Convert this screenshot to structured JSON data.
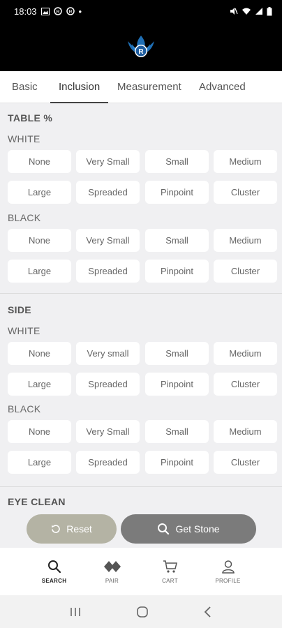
{
  "status_bar": {
    "time": "18:03",
    "dot": "•"
  },
  "app": {
    "logo_letter": "R"
  },
  "tabs": [
    {
      "label": "Basic"
    },
    {
      "label": "Inclusion",
      "active": true
    },
    {
      "label": "Measurement"
    },
    {
      "label": "Advanced"
    }
  ],
  "sections": {
    "table": {
      "title": "TABLE %",
      "white": {
        "label": "WHITE",
        "options": [
          "None",
          "Very Small",
          "Small",
          "Medium",
          "Large",
          "Spreaded",
          "Pinpoint",
          "Cluster"
        ]
      },
      "black": {
        "label": "BLACK",
        "options": [
          "None",
          "Very Small",
          "Small",
          "Medium",
          "Large",
          "Spreaded",
          "Pinpoint",
          "Cluster"
        ]
      }
    },
    "side": {
      "title": "SIDE",
      "white": {
        "label": "WHITE",
        "options": [
          "None",
          "Very small",
          "Small",
          "Medium",
          "Large",
          "Spreaded",
          "Pinpoint",
          "Cluster"
        ]
      },
      "black": {
        "label": "BLACK",
        "options": [
          "None",
          "Very Small",
          "Small",
          "Medium",
          "Large",
          "Spreaded",
          "Pinpoint",
          "Cluster"
        ]
      }
    },
    "eye_clean": {
      "title": "EYE CLEAN"
    }
  },
  "actions": {
    "reset_label": "Reset",
    "get_stone_label": "Get Stone"
  },
  "bottom_nav": [
    {
      "label": "SEARCH",
      "icon": "search-icon",
      "active": true
    },
    {
      "label": "PAIR",
      "icon": "pair-icon"
    },
    {
      "label": "CART",
      "icon": "cart-icon"
    },
    {
      "label": "PROFILE",
      "icon": "profile-icon"
    }
  ],
  "colors": {
    "reset_button": "#b4b3a4",
    "get_stone_button": "#7b7b7b",
    "header": "#000000",
    "logo": "#1f6fb5"
  }
}
